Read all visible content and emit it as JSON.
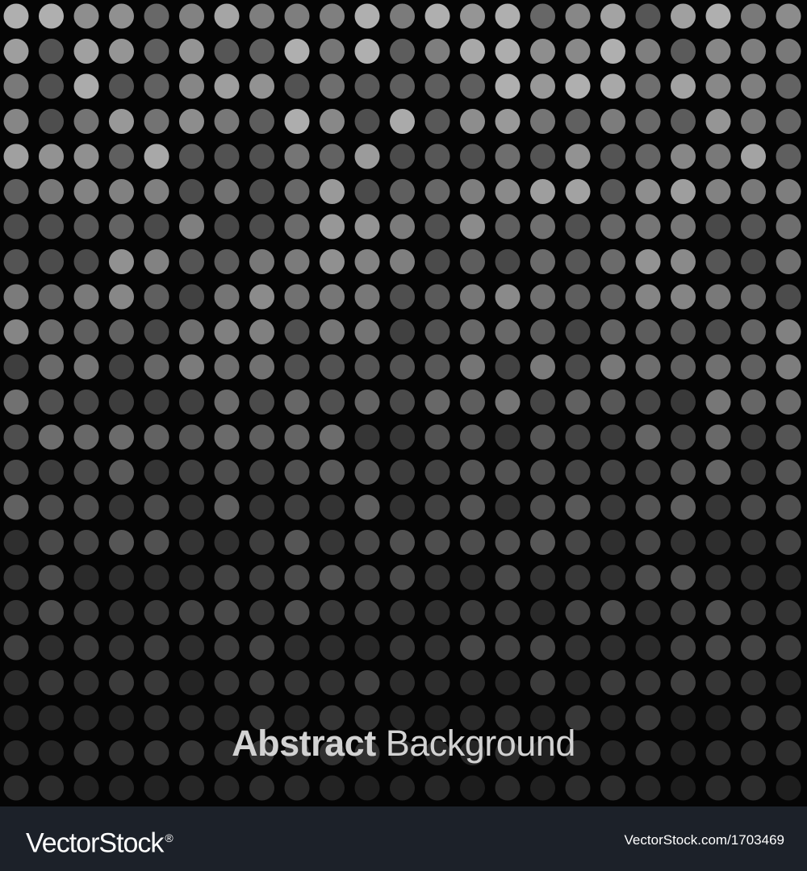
{
  "artwork": {
    "headline_bold": "Abstract",
    "headline_light": "Background",
    "background_color": "#050505",
    "dot_color": "#9a9a9a",
    "text_color": "#d2d2d2"
  },
  "footer": {
    "logo_text": "VectorStock",
    "logo_mark": "®",
    "image_id": "VectorStock.com/1703469",
    "background_color": "#1c2129"
  }
}
